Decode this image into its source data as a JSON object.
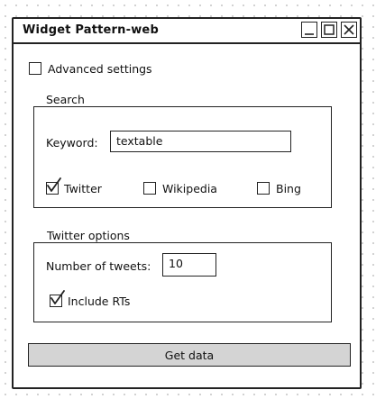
{
  "window": {
    "title": "Widget Pattern-web",
    "controls": [
      {
        "name": "minimize",
        "icon": "minimize-icon"
      },
      {
        "name": "maximize",
        "icon": "maximize-icon"
      },
      {
        "name": "close",
        "icon": "close-icon"
      }
    ]
  },
  "advanced_settings": {
    "label": "Advanced settings",
    "checked": false
  },
  "search": {
    "group_label": "Search",
    "keyword_label": "Keyword:",
    "keyword_value": "textable",
    "sources": [
      {
        "label": "Twitter",
        "checked": true
      },
      {
        "label": "Wikipedia",
        "checked": false
      },
      {
        "label": "Bing",
        "checked": false
      }
    ]
  },
  "twitter_options": {
    "group_label": "Twitter options",
    "tweets_label": "Number of tweets:",
    "tweets_value": "10",
    "include_rts_label": "Include RTs",
    "include_rts_checked": true
  },
  "actions": {
    "get_data_label": "Get data"
  },
  "colors": {
    "border": "#222222",
    "button_fill": "#d4d4d4",
    "background_dots": "#cfcfcf"
  }
}
